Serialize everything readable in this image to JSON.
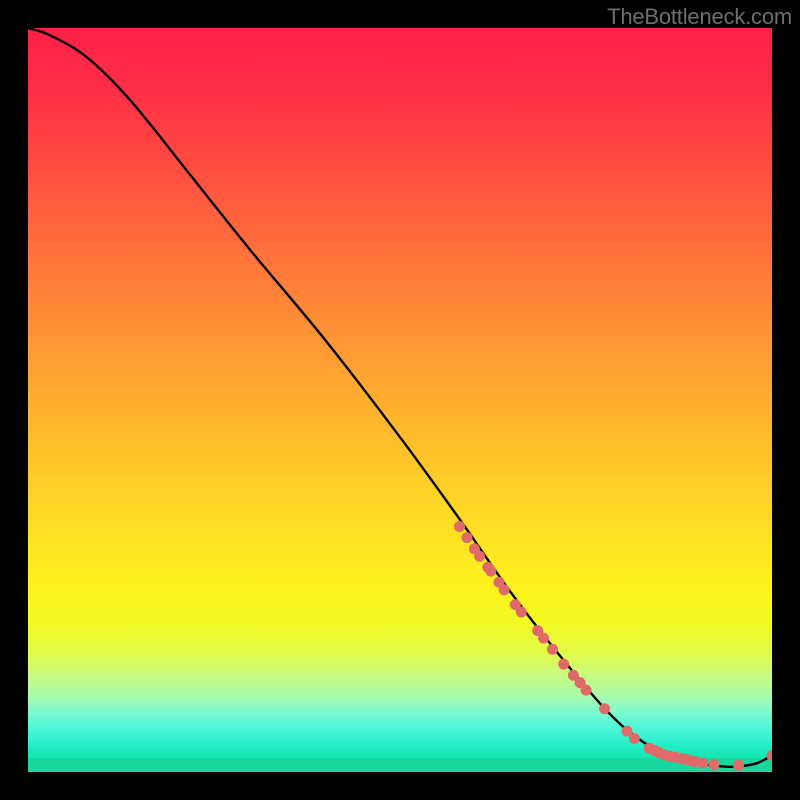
{
  "watermark": "TheBottleneck.com",
  "chart_data": {
    "type": "line",
    "title": "",
    "xlabel": "",
    "ylabel": "",
    "xlim": [
      0,
      100
    ],
    "ylim": [
      0,
      100
    ],
    "grid": false,
    "legend": false,
    "series": [
      {
        "name": "bottleneck-curve",
        "x": [
          0,
          3,
          8,
          14,
          22,
          30,
          40,
          50,
          58,
          65,
          72,
          78,
          82,
          85,
          88,
          90,
          92,
          94,
          96,
          98,
          100
        ],
        "y": [
          100,
          99,
          96,
          90,
          80,
          70,
          58,
          45,
          34,
          24,
          15,
          8,
          4.5,
          2.8,
          1.8,
          1.2,
          0.9,
          0.7,
          0.8,
          1.2,
          2.2
        ]
      }
    ],
    "scatter_points": {
      "name": "data-points",
      "color": "#e06a68",
      "points": [
        {
          "x": 58,
          "y": 33
        },
        {
          "x": 59,
          "y": 31.5
        },
        {
          "x": 60,
          "y": 30
        },
        {
          "x": 60.7,
          "y": 29
        },
        {
          "x": 61.8,
          "y": 27.5
        },
        {
          "x": 62.2,
          "y": 27
        },
        {
          "x": 63.3,
          "y": 25.5
        },
        {
          "x": 64,
          "y": 24.5
        },
        {
          "x": 65.5,
          "y": 22.5
        },
        {
          "x": 66.3,
          "y": 21.5
        },
        {
          "x": 68.5,
          "y": 19
        },
        {
          "x": 69.3,
          "y": 18
        },
        {
          "x": 70.5,
          "y": 16.5
        },
        {
          "x": 72,
          "y": 14.5
        },
        {
          "x": 73.3,
          "y": 13
        },
        {
          "x": 74.2,
          "y": 12
        },
        {
          "x": 75,
          "y": 11
        },
        {
          "x": 77.5,
          "y": 8.5
        },
        {
          "x": 80.5,
          "y": 5.5
        },
        {
          "x": 81.5,
          "y": 4.5
        },
        {
          "x": 83.5,
          "y": 3.2
        },
        {
          "x": 84.2,
          "y": 2.9
        },
        {
          "x": 84.8,
          "y": 2.6
        },
        {
          "x": 85.5,
          "y": 2.3
        },
        {
          "x": 86.3,
          "y": 2.1
        },
        {
          "x": 87,
          "y": 2
        },
        {
          "x": 87.8,
          "y": 1.8
        },
        {
          "x": 88.5,
          "y": 1.7
        },
        {
          "x": 89.2,
          "y": 1.5
        },
        {
          "x": 89.7,
          "y": 1.4
        },
        {
          "x": 90.7,
          "y": 1.2
        },
        {
          "x": 92.2,
          "y": 1.0
        },
        {
          "x": 95.5,
          "y": 0.9
        },
        {
          "x": 100,
          "y": 2.2
        }
      ]
    }
  }
}
